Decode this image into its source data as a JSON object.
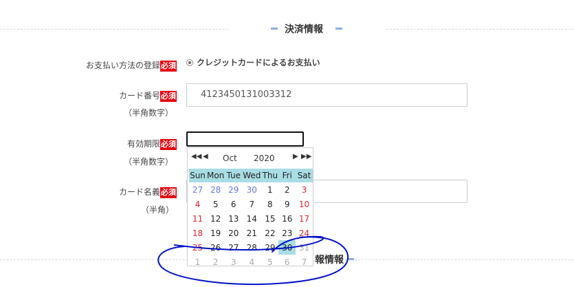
{
  "section": {
    "title": "決済情報",
    "bottom_title_partial": "報情報"
  },
  "payment_method": {
    "label": "お支払い方法の登録",
    "required": "必須",
    "option": "クレジットカードによるお支払い"
  },
  "card_number": {
    "label": "カード番号",
    "required": "必須",
    "sub": "（半角数字）",
    "value": "4123450131003312"
  },
  "expiry": {
    "label": "有効期限",
    "required": "必須",
    "sub": "（半角数字）",
    "value": ""
  },
  "card_name": {
    "label": "カード名義",
    "required": "必須",
    "sub": "（半角）",
    "value": ""
  },
  "calendar": {
    "prev_year": "◀◀",
    "prev_month": "◀",
    "next_month": "▶",
    "next_year": "▶▶",
    "month": "Oct",
    "year": "2020",
    "weekdays": [
      "Sun",
      "Mon",
      "Tue",
      "Wed",
      "Thu",
      "Fri",
      "Sat"
    ],
    "weeks": [
      [
        "27",
        "28",
        "29",
        "30",
        "1",
        "2",
        "3"
      ],
      [
        "4",
        "5",
        "6",
        "7",
        "8",
        "9",
        "10"
      ],
      [
        "11",
        "12",
        "13",
        "14",
        "15",
        "16",
        "17"
      ],
      [
        "18",
        "19",
        "20",
        "21",
        "22",
        "23",
        "24"
      ],
      [
        "25",
        "26",
        "27",
        "28",
        "29",
        "30",
        "31"
      ],
      [
        "1",
        "2",
        "3",
        "4",
        "5",
        "6",
        "7"
      ]
    ],
    "today": "30"
  },
  "colors": {
    "required_bg": "#e3000b",
    "header_bg": "#a9dde5",
    "weekend": "#e0242e",
    "prev_month": "#6677e0",
    "annotation": "#0010c8"
  }
}
